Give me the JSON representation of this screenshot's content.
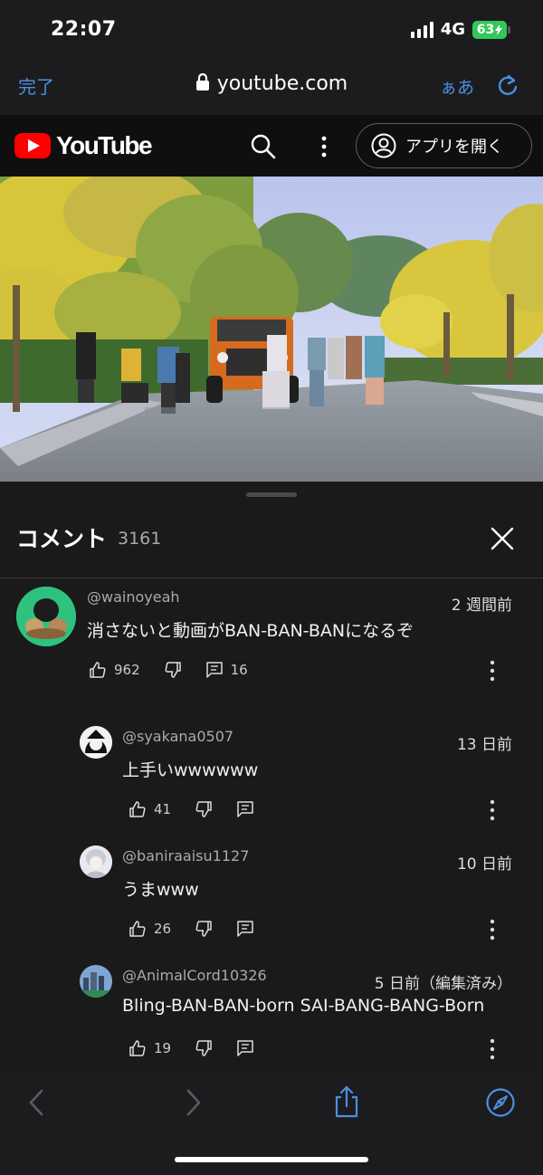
{
  "status": {
    "time": "22:07",
    "network": "4G",
    "battery": "63"
  },
  "safari": {
    "done": "完了",
    "url": "youtube.com",
    "text_size": "ぁあ"
  },
  "youtube": {
    "logo_text": "YouTube",
    "open_app": "アプリを開く"
  },
  "comments_panel": {
    "title": "コメント",
    "count": "3161"
  },
  "comments": [
    {
      "author": "@wainoyeah",
      "time": "2 週間前",
      "text": "消さないと動画がBAN-BAN-BANになるぞ",
      "likes": "962",
      "replies": "16"
    },
    {
      "author": "@syakana0507",
      "time": "13 日前",
      "text": "上手いwwwwww",
      "likes": "41"
    },
    {
      "author": "@baniraaisu1127",
      "time": "10 日前",
      "text": "うまwww",
      "likes": "26"
    },
    {
      "author": "@AnimalCord10326",
      "time": "5 日前（編集済み）",
      "text": "Bling-BAN-BAN-born SAI-BANG-BANG-Born",
      "likes": "19"
    }
  ],
  "colors": {
    "accent": "#4a90e2",
    "brand": "#ff0000",
    "battery": "#34c759"
  }
}
